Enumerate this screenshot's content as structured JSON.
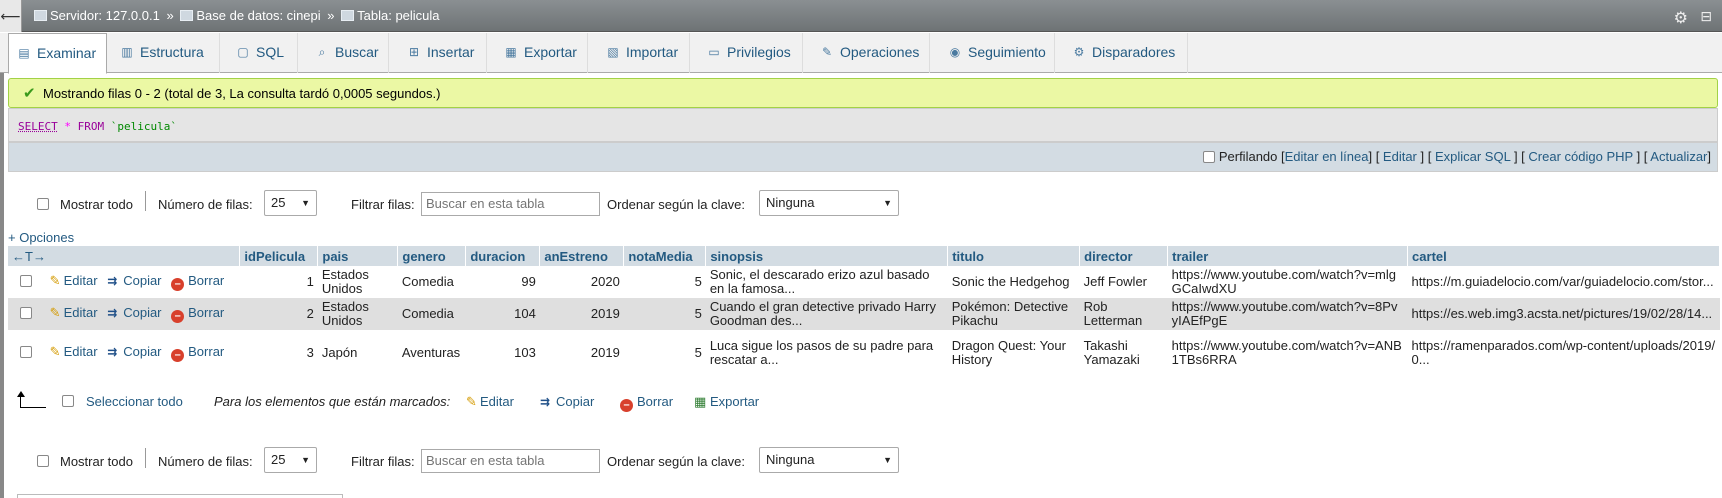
{
  "breadcrumb": {
    "server_label": "Servidor: 127.0.0.1",
    "db_label": "Base de datos: cinepi",
    "table_label": "Tabla: pelicula",
    "separator": "»",
    "back": "⟵"
  },
  "tabs": [
    {
      "label": "Examinar",
      "icon": "browse-icon"
    },
    {
      "label": "Estructura",
      "icon": "structure-icon"
    },
    {
      "label": "SQL",
      "icon": "sql-icon"
    },
    {
      "label": "Buscar",
      "icon": "search-icon"
    },
    {
      "label": "Insertar",
      "icon": "insert-icon"
    },
    {
      "label": "Exportar",
      "icon": "export-icon"
    },
    {
      "label": "Importar",
      "icon": "import-icon"
    },
    {
      "label": "Privilegios",
      "icon": "privileges-icon"
    },
    {
      "label": "Operaciones",
      "icon": "operations-icon"
    },
    {
      "label": "Seguimiento",
      "icon": "tracking-icon"
    },
    {
      "label": "Disparadores",
      "icon": "triggers-icon"
    }
  ],
  "message": "Mostrando filas 0 - 2 (total de 3, La consulta tardó 0,0005 segundos.)",
  "sql": {
    "select": "SELECT",
    "star": "*",
    "from": "FROM",
    "table": "`pelicula`"
  },
  "profiling": {
    "label": "Perfilando",
    "links": [
      "Editar en línea",
      "Editar",
      "Explicar SQL",
      "Crear código PHP",
      "Actualizar"
    ]
  },
  "nav": {
    "show_all": "Mostrar todo",
    "rows_label": "Número de filas:",
    "rows_value": "25",
    "filter_label": "Filtrar filas:",
    "filter_placeholder": "Buscar en esta tabla",
    "order_label": "Ordenar según la clave:",
    "order_value": "Ninguna"
  },
  "options_link": "+ Opciones",
  "table": {
    "arrows": "←T→",
    "columns": [
      "idPelicula",
      "pais",
      "genero",
      "duracion",
      "anEstreno",
      "notaMedia",
      "sinopsis",
      "titulo",
      "director",
      "trailer",
      "cartel"
    ],
    "actions": {
      "edit": "Editar",
      "copy": "Copiar",
      "delete": "Borrar"
    },
    "rows": [
      [
        "1",
        "Estados Unidos",
        "Comedia",
        "99",
        "2020",
        "5",
        "Sonic, el descarado erizo azul basado en la famosa...",
        "Sonic the Hedgehog",
        "Jeff Fowler",
        "https://www.youtube.com/watch?v=mlgGCaIwdXU",
        "https://m.guiadelocio.com/var/guiadelocio.com/stor..."
      ],
      [
        "2",
        "Estados Unidos",
        "Comedia",
        "104",
        "2019",
        "5",
        "Cuando el gran detective privado Harry Goodman des...",
        "Pokémon: Detective Pikachu",
        "Rob Letterman",
        "https://www.youtube.com/watch?v=8PvyIAEfPgE",
        "https://es.web.img3.acsta.net/pictures/19/02/28/14..."
      ],
      [
        "3",
        "Japón",
        "Aventuras",
        "103",
        "2019",
        "5",
        "Luca sigue los pasos de su padre para rescatar a...",
        "Dragon Quest: Your History",
        "Takashi Yamazaki",
        "https://www.youtube.com/watch?v=ANB1TBs6RRA",
        "https://ramenparados.com/wp-content/uploads/2019/0..."
      ]
    ]
  },
  "bulk": {
    "select_all": "Seleccionar todo",
    "marked_label": "Para los elementos que están marcados:",
    "edit": "Editar",
    "copy": "Copiar",
    "delete": "Borrar",
    "export": "Exportar"
  },
  "colors": {
    "link": "#235a81",
    "success_bg": "#ebf8a4",
    "header_bg": "#d3dce3",
    "row_alt": "#dfdfdf"
  }
}
